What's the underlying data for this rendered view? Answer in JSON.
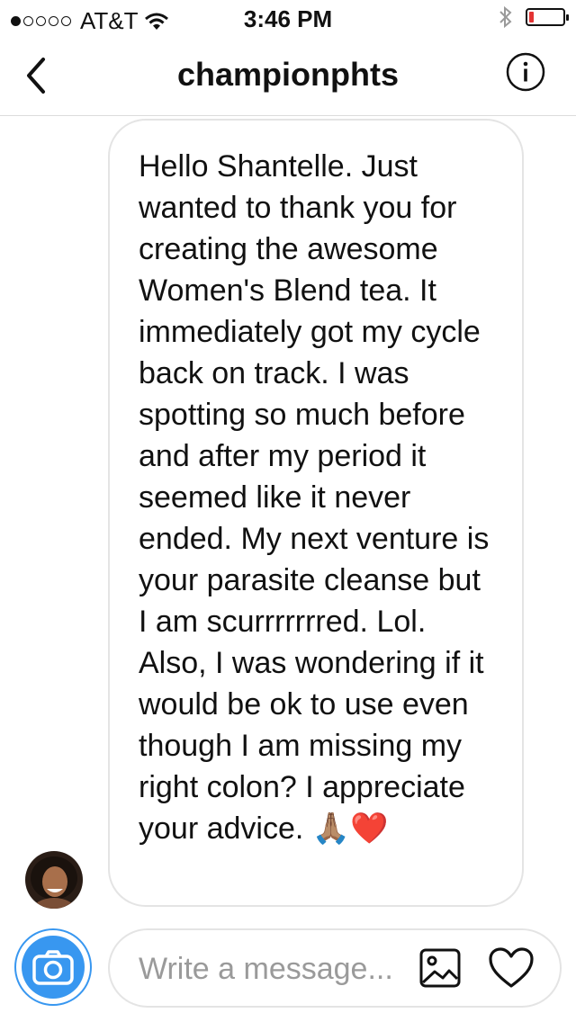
{
  "status_bar": {
    "carrier": "AT&T",
    "time": "3:46 PM",
    "signal_bars_filled": 1,
    "signal_bars_total": 5,
    "battery_level": 0.15,
    "battery_color": "#e33333"
  },
  "header": {
    "title": "championphts",
    "back_icon": "chevron-left-icon",
    "info_icon": "info-icon"
  },
  "message": {
    "text": "Hello Shantelle. Just wanted to thank you for creating the awesome Women's Blend tea. It immediately got my cycle back on track. I was spotting so much before and after my period it seemed like it never ended. My next venture is your parasite cleanse but I am scurrrrrrred. Lol. Also, I was wondering if it would be ok to use even though I am missing my right colon? I appreciate your advice. 🙏🏽❤️"
  },
  "composer": {
    "placeholder": "Write a message...",
    "value": "",
    "camera_icon": "camera-icon",
    "gallery_icon": "gallery-icon",
    "like_icon": "heart-icon",
    "accent": "#3897f0"
  }
}
